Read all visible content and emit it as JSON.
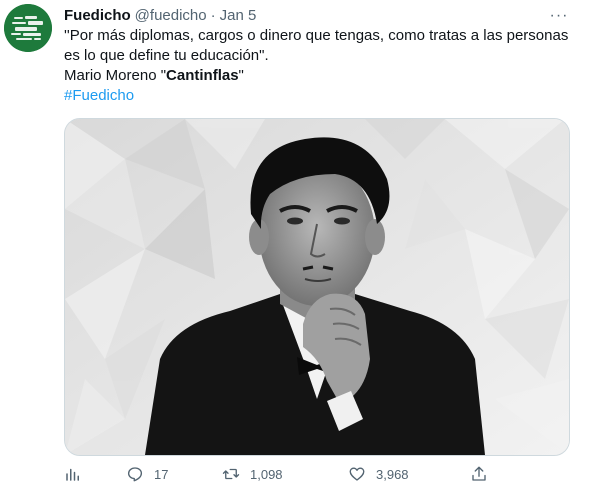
{
  "tweet": {
    "author_name": "Fuedicho",
    "author_handle": "@fuedicho",
    "separator": "·",
    "date": "Jan 5",
    "more_label": "···",
    "text_line1": "''Por más diplomas, cargos o dinero que tengas, como tratas a las personas",
    "text_line2": "es lo que define tu educación\".",
    "attribution_prefix": "Mario Moreno \"",
    "attribution_bold": "Cantinflas",
    "attribution_suffix": "\"",
    "hashtag": "#Fuedicho"
  },
  "actions": {
    "reply_count": "17",
    "retweet_count": "1,098",
    "like_count": "3,968"
  },
  "icons": {
    "avatar": "frases-logo",
    "more": "more-icon",
    "analytics": "analytics-icon",
    "reply": "reply-icon",
    "retweet": "retweet-icon",
    "like": "heart-icon",
    "share": "share-icon"
  },
  "colors": {
    "link": "#1d9bf0",
    "secondary_text": "#536471",
    "avatar_bg": "#1e7a3c"
  }
}
